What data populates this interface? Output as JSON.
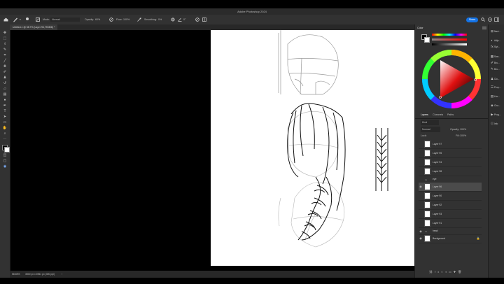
{
  "app": {
    "title": "Adobe Photoshop 2024"
  },
  "options_bar": {
    "mode_label": "Mode:",
    "mode_value": "Normal",
    "opacity_label": "Opacity:",
    "opacity_value": "60%",
    "flow_label": "Flow:",
    "flow_value": "100%",
    "smoothing_label": "Smoothing:",
    "smoothing_value": "0%",
    "angle_value": "0°",
    "share_label": "Share"
  },
  "document": {
    "tab_label": "Untitled-1 @ 58.7% (Layer 96, RGB/8) *"
  },
  "status": {
    "zoom": "58.65%",
    "doc_info": "3500 px x 4961 px (300 ppi)"
  },
  "color_panel": {
    "tab": "Color"
  },
  "layers_panel": {
    "tabs": [
      "Layers",
      "Channels",
      "Paths"
    ],
    "kind_label": "Kind",
    "blend_mode": "Normal",
    "opacity_label": "Opacity:",
    "opacity_value": "100%",
    "lock_label": "Lock:",
    "fill_label": "Fill:",
    "fill_value": "100%",
    "layers": [
      {
        "name": "Layer 97"
      },
      {
        "name": "Layer 95"
      },
      {
        "name": "Layer 94"
      },
      {
        "name": "Layer 98"
      },
      {
        "name": "eye"
      },
      {
        "name": "Layer 96"
      },
      {
        "name": "Layer 90"
      },
      {
        "name": "Layer 92"
      },
      {
        "name": "Layer 93"
      },
      {
        "name": "Layer 91"
      },
      {
        "name": "head"
      },
      {
        "name": "Background"
      }
    ]
  },
  "side_panels": [
    {
      "label": "Navi...",
      "icon": "navigator-icon"
    },
    {
      "label": "Adju...",
      "icon": "adjustments-icon"
    },
    {
      "label": "Styl...",
      "icon": "styles-icon"
    },
    {
      "label": "Swa...",
      "icon": "swatches-icon"
    },
    {
      "label": "Bru...",
      "icon": "brushes-icon"
    },
    {
      "label": "Bru...",
      "icon": "brush-settings-icon"
    },
    {
      "label": "Clo...",
      "icon": "clone-source-icon"
    },
    {
      "label": "Prop...",
      "icon": "properties-icon"
    },
    {
      "label": "Libr...",
      "icon": "libraries-icon"
    },
    {
      "label": "Cha...",
      "icon": "channels-icon"
    },
    {
      "label": "Prog...",
      "icon": "progress-icon"
    },
    {
      "label": "Info",
      "icon": "info-icon"
    }
  ],
  "tools": [
    "move",
    "marquee",
    "lasso",
    "quick-select",
    "crop",
    "eyedropper",
    "healing",
    "brush",
    "stamp",
    "history-brush",
    "eraser",
    "gradient",
    "dodge",
    "pen",
    "type",
    "path-select",
    "rectangle",
    "hand",
    "zoom"
  ],
  "colors": {
    "accent": "#1473e6",
    "foreground": "#000000",
    "background": "#ffffff"
  }
}
